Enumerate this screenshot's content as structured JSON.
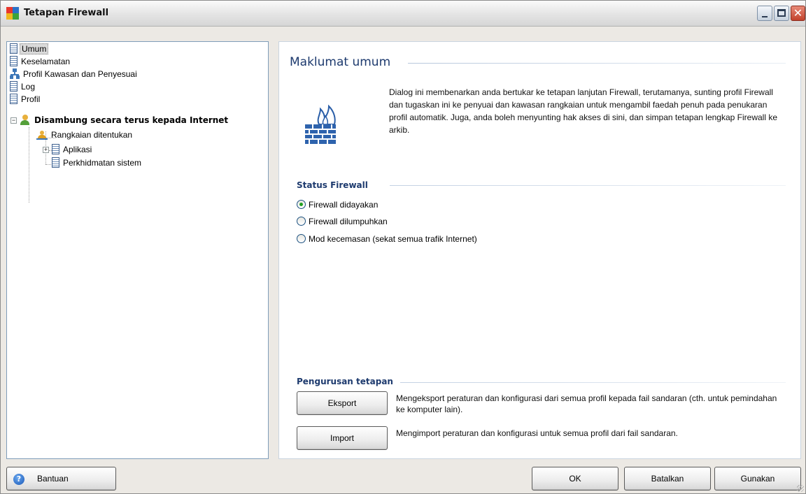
{
  "window": {
    "title": "Tetapan Firewall"
  },
  "tree": {
    "items": [
      {
        "label": "Umum"
      },
      {
        "label": "Keselamatan"
      },
      {
        "label": "Profil Kawasan dan Penyesuai"
      },
      {
        "label": "Log"
      },
      {
        "label": "Profil"
      },
      {
        "label": "Disambung secara terus kepada Internet"
      },
      {
        "label": "Rangkaian ditentukan"
      },
      {
        "label": "Aplikasi"
      },
      {
        "label": "Perkhidmatan sistem"
      }
    ]
  },
  "main": {
    "title": "Maklumat umum",
    "description": "Dialog ini membenarkan anda bertukar ke tetapan lanjutan Firewall, terutamanya, sunting profil Firewall dan tugaskan ini ke penyuai dan kawasan rangkaian untuk mengambil faedah penuh pada penukaran profil automatik. Juga, anda boleh menyunting hak akses di sini, dan simpan tetapan lengkap  Firewall ke arkib.",
    "status": {
      "title": "Status Firewall",
      "options": [
        {
          "label": "Firewall didayakan",
          "selected": true
        },
        {
          "label": "Firewall dilumpuhkan",
          "selected": false
        },
        {
          "label": "Mod kecemasan (sekat semua trafik Internet)",
          "selected": false
        }
      ]
    },
    "management": {
      "title": "Pengurusan tetapan",
      "export_label": "Eksport",
      "export_desc": "Mengeksport peraturan dan konfigurasi dari semua profil kepada fail sandaran (cth. untuk pemindahan ke komputer lain).",
      "import_label": "Import",
      "import_desc": "Mengimport peraturan dan konfigurasi untuk semua profil dari fail sandaran."
    }
  },
  "footer": {
    "help_label": "Bantuan",
    "ok_label": "OK",
    "cancel_label": "Batalkan",
    "apply_label": "Gunakan"
  },
  "colors": {
    "heading": "#1d3a6e",
    "radio_checked": "#21a121"
  }
}
